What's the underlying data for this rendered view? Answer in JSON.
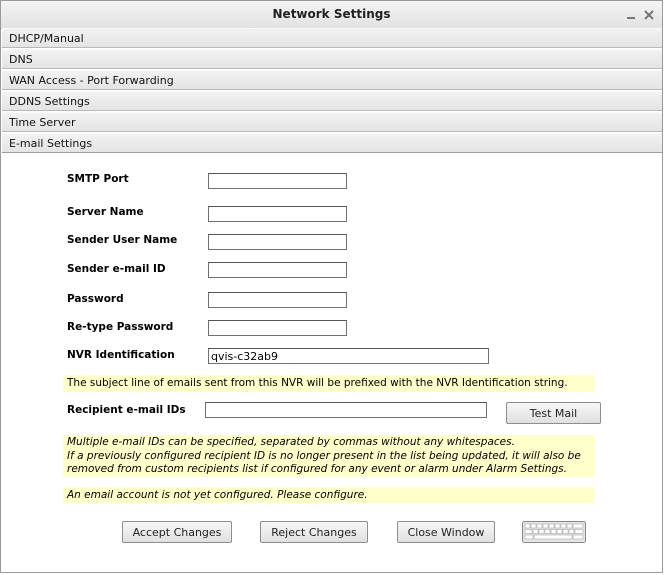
{
  "window": {
    "title": "Network Settings"
  },
  "sections": [
    {
      "label": "DHCP/Manual"
    },
    {
      "label": "DNS"
    },
    {
      "label": "WAN Access - Port Forwarding"
    },
    {
      "label": "DDNS Settings"
    },
    {
      "label": "Time Server"
    },
    {
      "label": "E-mail Settings"
    }
  ],
  "email": {
    "smtp_port_label": "SMTP Port",
    "smtp_port_value": "",
    "server_name_label": "Server Name",
    "server_name_value": "",
    "sender_user_label": "Sender User Name",
    "sender_user_value": "",
    "sender_email_label": "Sender e-mail ID",
    "sender_email_value": "",
    "password_label": "Password",
    "password_value": "",
    "retype_password_label": "Re-type Password",
    "retype_password_value": "",
    "nvr_id_label": "NVR Identification",
    "nvr_id_value": "qvis-c32ab9",
    "subject_note": "The subject line of emails sent from this NVR will be prefixed with the NVR Identification string.",
    "recipient_label": "Recipient e-mail IDs",
    "recipient_value": "",
    "test_mail_button": "Test Mail",
    "multi_note_1": "Multiple e-mail IDs can be specified, separated by commas without any whitespaces.",
    "multi_note_2": "If a previously configured recipient ID is no longer present in the list being updated, it will also be",
    "multi_note_3": "removed from custom recipients list if configured for any event or alarm under Alarm Settings.",
    "status_note": "An email account is not yet configured. Please configure."
  },
  "actions": {
    "accept": "Accept Changes",
    "reject": "Reject Changes",
    "close": "Close Window"
  },
  "icons": {
    "minimize": "minimize-icon",
    "close": "close-icon",
    "keyboard": "keyboard-icon"
  },
  "colors": {
    "note_bg": "#ffffcc",
    "titlebar": "#e8e8e8"
  }
}
